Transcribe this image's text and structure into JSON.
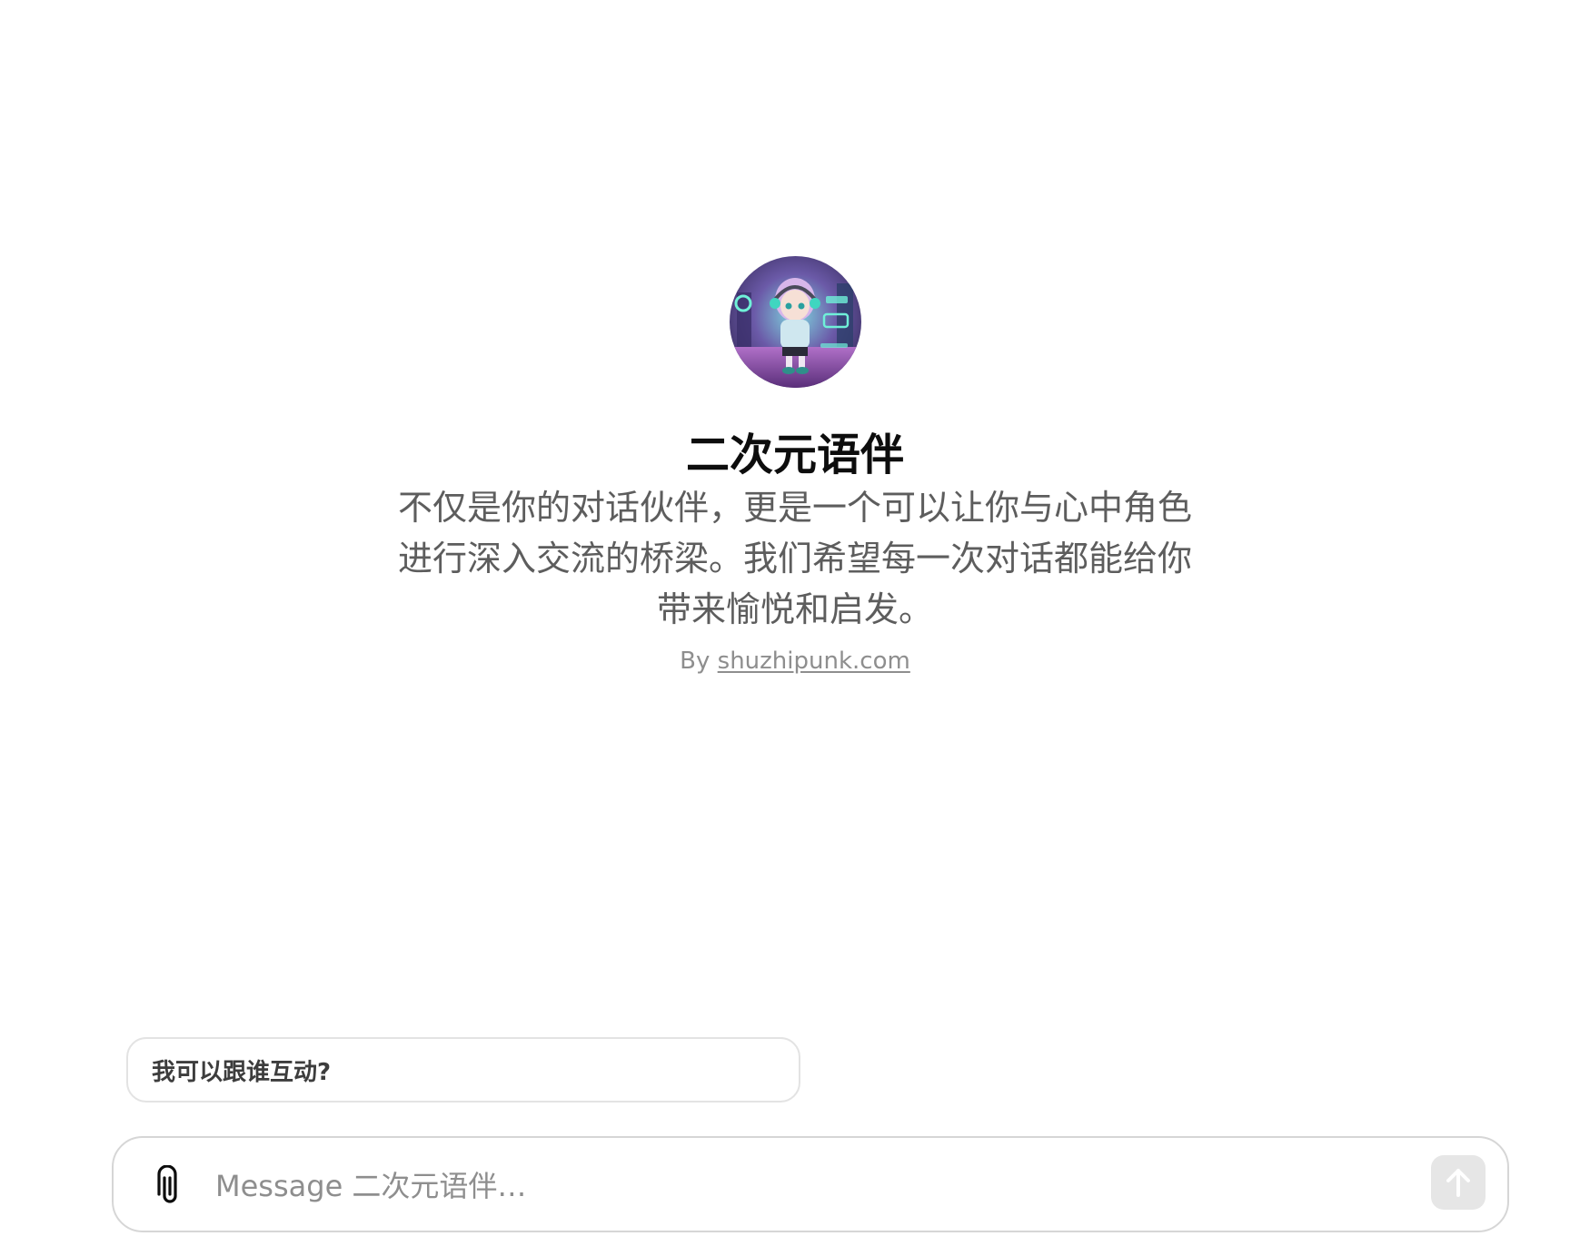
{
  "gpt": {
    "name": "二次元语伴",
    "description": "不仅是你的对话伙伴，更是一个可以让你与心中角色进行深入交流的桥梁。我们希望每一次对话都能给你带来愉悦和启发。",
    "byline_prefix": "By",
    "author_link": "shuzhipunk.com"
  },
  "conversation_starters": [
    {
      "label": "我可以跟谁互动?"
    }
  ],
  "composer": {
    "placeholder": "Message 二次元语伴…",
    "value": ""
  },
  "icons": {
    "attach": "paperclip-icon",
    "send": "arrow-up-icon"
  }
}
